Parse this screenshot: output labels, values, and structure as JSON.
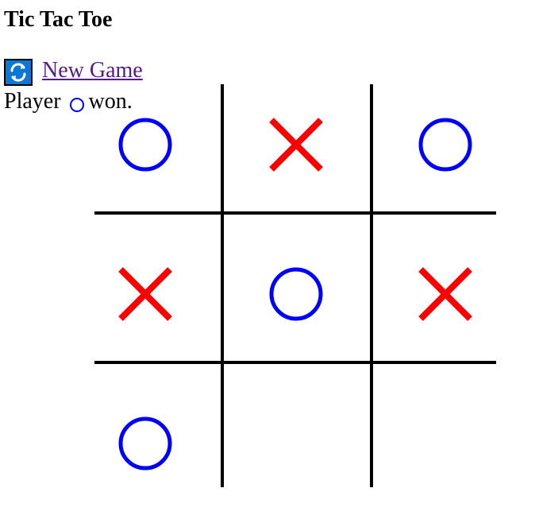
{
  "title": "Tic Tac Toe",
  "new_game": {
    "label": " New Game",
    "icon": "refresh-icon"
  },
  "status": {
    "prefix": "Player",
    "winner": "O",
    "suffix": "won."
  },
  "board": {
    "cells": [
      "O",
      "X",
      "O",
      "X",
      "O",
      "X",
      "O",
      "",
      ""
    ],
    "x_color": "#ff0000",
    "o_color": "#0000ff",
    "line_color": "#000000"
  },
  "colors": {
    "link": "#551a8b",
    "icon_background": "#0a78d4"
  }
}
